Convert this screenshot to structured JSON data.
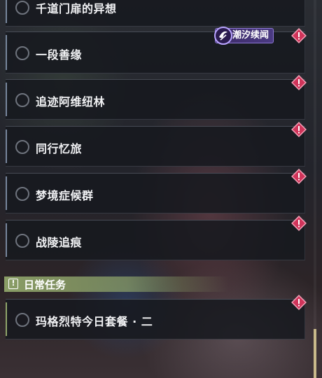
{
  "quests": [
    {
      "label": "千道门扉的异想",
      "alert": false
    },
    {
      "label": "一段善缘",
      "alert": true
    },
    {
      "label": "追迹阿维纽林",
      "alert": true
    },
    {
      "label": "同行忆旅",
      "alert": true
    },
    {
      "label": "梦境症候群",
      "alert": true
    },
    {
      "label": "战陵追痕",
      "alert": true
    }
  ],
  "tag": {
    "label": "潮汐续闻",
    "icon": "tide-story-icon"
  },
  "section": {
    "label": "日常任务",
    "icon": "exclamation-icon"
  },
  "daily_quests": [
    {
      "label": "玛格烈特今日套餐 · 二",
      "alert": true
    }
  ],
  "colors": {
    "accent_green": "#8fa46a",
    "alert_red": "#d0345a",
    "tag_purple": "#4a3a82"
  },
  "scrollbar": {
    "position": "bottom"
  }
}
